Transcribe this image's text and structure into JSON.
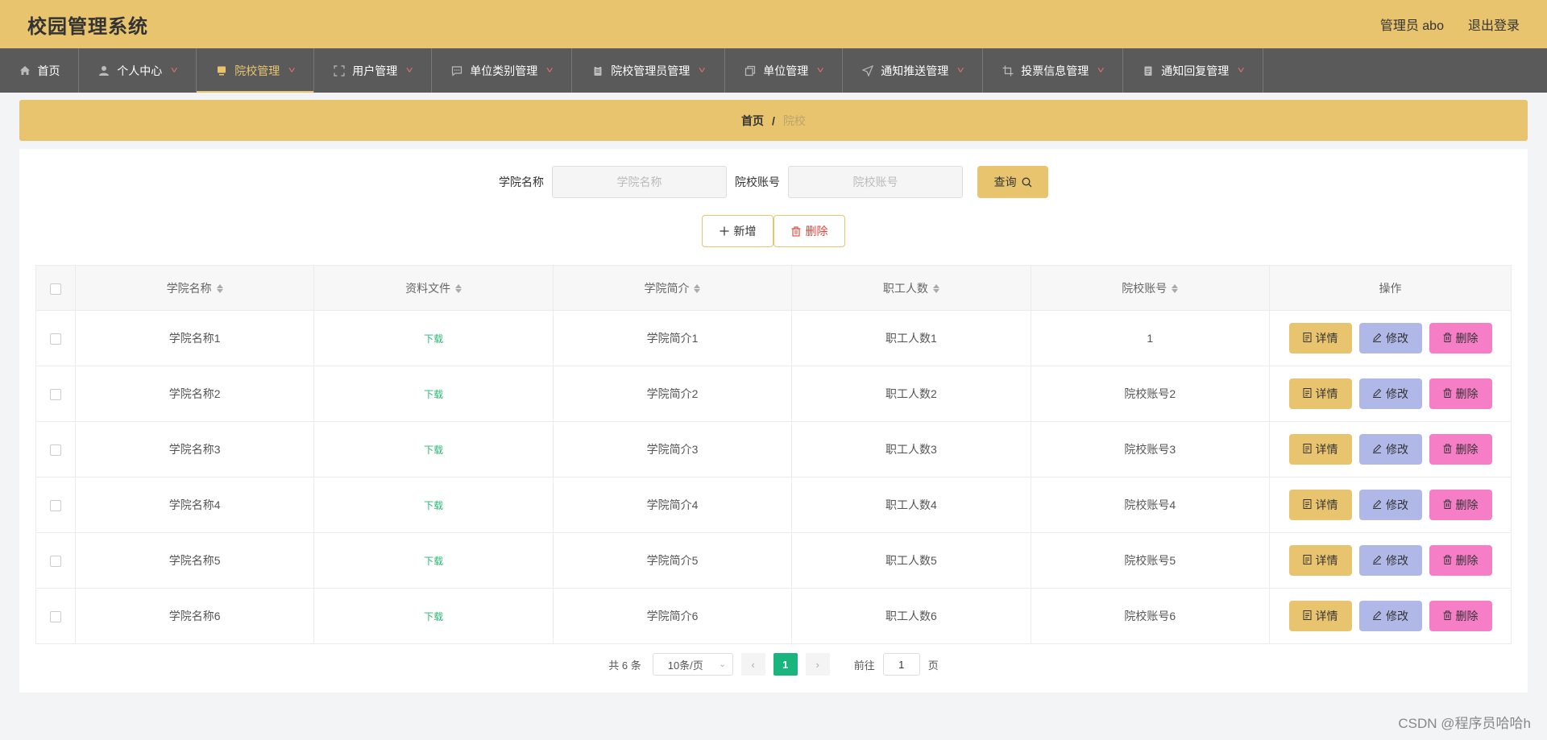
{
  "header": {
    "title": "校园管理系统",
    "user": "管理员 abo",
    "logout": "退出登录"
  },
  "nav": [
    {
      "label": "首页",
      "icon": "home-icon",
      "caret": false,
      "active": false
    },
    {
      "label": "个人中心",
      "icon": "user-icon",
      "caret": true,
      "active": false
    },
    {
      "label": "院校管理",
      "icon": "monitor-icon",
      "caret": true,
      "active": true
    },
    {
      "label": "用户管理",
      "icon": "fullscreen-icon",
      "caret": true,
      "active": false
    },
    {
      "label": "单位类别管理",
      "icon": "chat-icon",
      "caret": true,
      "active": false
    },
    {
      "label": "院校管理员管理",
      "icon": "clipboard-icon",
      "caret": true,
      "active": false
    },
    {
      "label": "单位管理",
      "icon": "copy-icon",
      "caret": true,
      "active": false
    },
    {
      "label": "通知推送管理",
      "icon": "send-icon",
      "caret": true,
      "active": false
    },
    {
      "label": "投票信息管理",
      "icon": "crop-icon",
      "caret": true,
      "active": false
    },
    {
      "label": "通知回复管理",
      "icon": "document-icon",
      "caret": true,
      "active": false
    }
  ],
  "breadcrumb": {
    "home": "首页",
    "sep": "/",
    "current": "院校"
  },
  "search": {
    "name_label": "学院名称",
    "name_placeholder": "学院名称",
    "account_label": "院校账号",
    "account_placeholder": "院校账号",
    "query": "查询"
  },
  "actions": {
    "add": "新增",
    "delete": "删除"
  },
  "table": {
    "headers": [
      "学院名称",
      "资料文件",
      "学院简介",
      "职工人数",
      "院校账号",
      "操作"
    ],
    "rows": [
      {
        "name": "学院名称1",
        "file": "下载",
        "intro": "学院简介1",
        "staff": "职工人数1",
        "account": "1"
      },
      {
        "name": "学院名称2",
        "file": "下载",
        "intro": "学院简介2",
        "staff": "职工人数2",
        "account": "院校账号2"
      },
      {
        "name": "学院名称3",
        "file": "下载",
        "intro": "学院简介3",
        "staff": "职工人数3",
        "account": "院校账号3"
      },
      {
        "name": "学院名称4",
        "file": "下载",
        "intro": "学院简介4",
        "staff": "职工人数4",
        "account": "院校账号4"
      },
      {
        "name": "学院名称5",
        "file": "下载",
        "intro": "学院简介5",
        "staff": "职工人数5",
        "account": "院校账号5"
      },
      {
        "name": "学院名称6",
        "file": "下载",
        "intro": "学院简介6",
        "staff": "职工人数6",
        "account": "院校账号6"
      }
    ],
    "ops": {
      "detail": "详情",
      "edit": "修改",
      "remove": "删除"
    }
  },
  "pagination": {
    "total": "共 6 条",
    "page_size": "10条/页",
    "current": "1",
    "goto_label": "前往",
    "goto_value": "1",
    "page_unit": "页"
  },
  "watermark": "CSDN @程序员哈哈h",
  "colors": {
    "accent": "#e8c46e",
    "nav_bg": "#5b5a5a",
    "edit": "#b0b8e8",
    "remove": "#f57ec6",
    "pager": "#1ab57e",
    "download": "#2bb673"
  }
}
